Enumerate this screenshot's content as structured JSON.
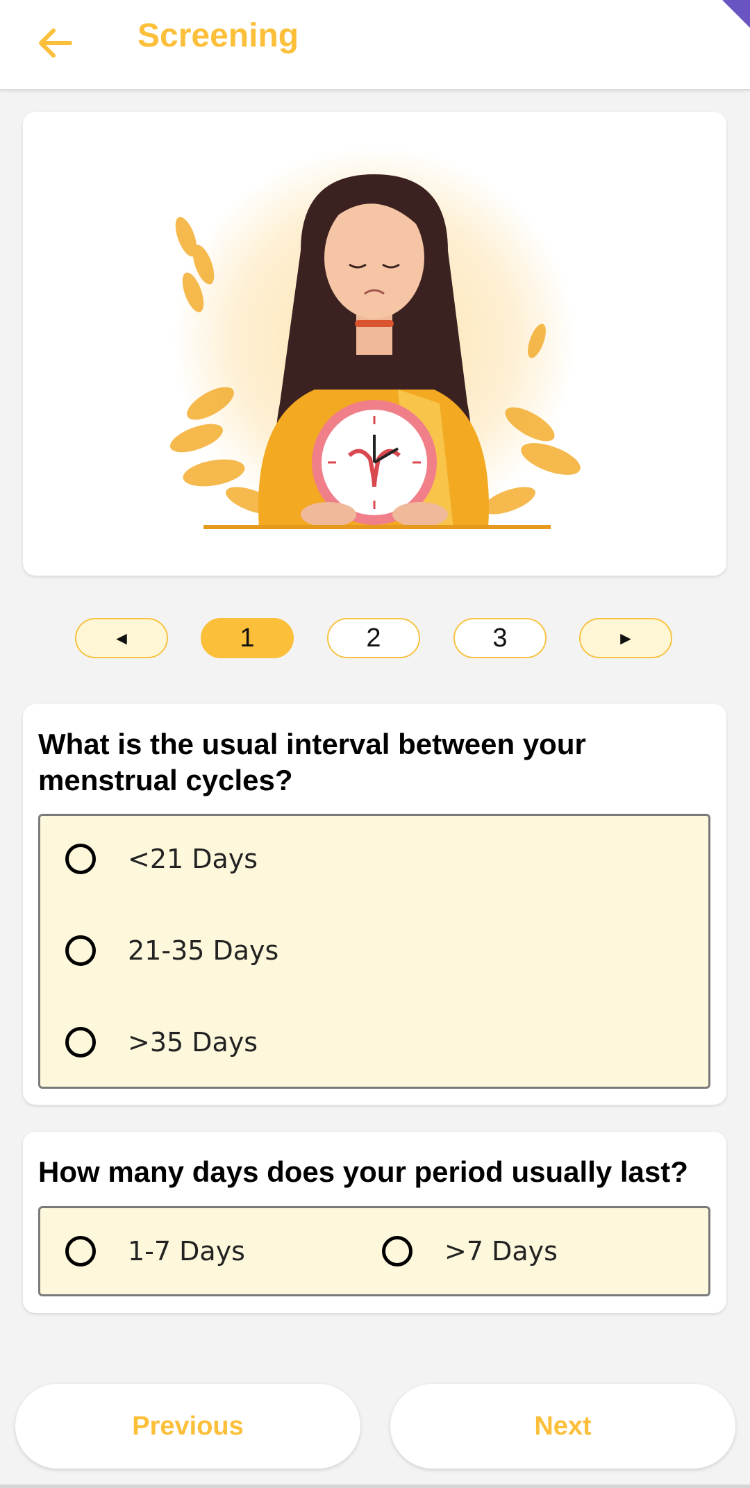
{
  "appbar": {
    "title": "Screening"
  },
  "pager": {
    "prev": "◄",
    "pages": [
      "1",
      "2",
      "3"
    ],
    "next": "►",
    "active": "1"
  },
  "questions": [
    {
      "text": "What is the usual interval between your menstrual cycles?",
      "options": [
        "<21 Days",
        "21-35 Days",
        ">35 Days"
      ]
    },
    {
      "text": "How many days does your period usually last?",
      "options": [
        "1-7 Days",
        ">7 Days"
      ]
    }
  ],
  "nav": {
    "previous": "Previous",
    "next": "Next"
  },
  "colors": {
    "accent": "#fbbf3a",
    "option_bg": "#fdf8dc",
    "ribbon": "#6a54c2"
  }
}
